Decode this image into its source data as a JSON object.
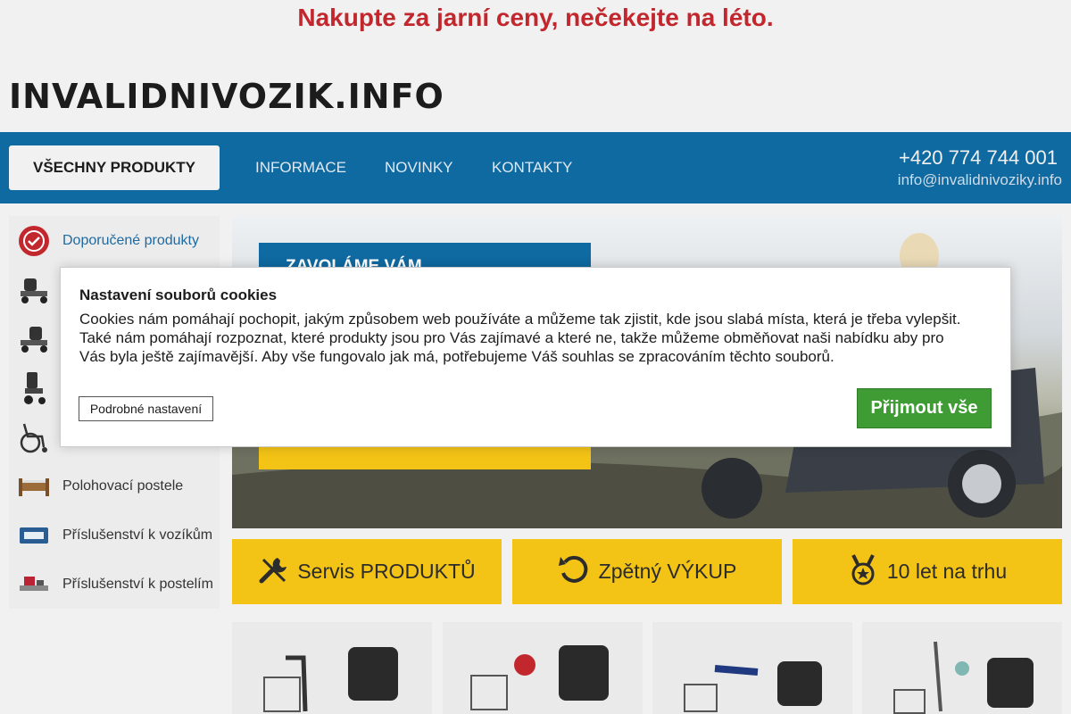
{
  "promo_banner": "Nakupte za jarní ceny, nečekejte na léto.",
  "logo": "INVALIDNIVOZIK.INFO",
  "nav": {
    "all_products": "VŠECHNY PRODUKTY",
    "links": [
      "INFORMACE",
      "NOVINKY",
      "KONTAKTY"
    ],
    "phone": "+420 774 744 001",
    "email": "info@invalidnivoziky.info"
  },
  "sidebar": {
    "items": [
      {
        "label": "Doporučené produkty",
        "icon": "recommended-badge-icon"
      },
      {
        "label": "",
        "icon": "mobility-scooter-icon"
      },
      {
        "label": "",
        "icon": "mobility-scooter-icon"
      },
      {
        "label": "",
        "icon": "electric-wheelchair-icon"
      },
      {
        "label": "",
        "icon": "wheelchair-icon"
      },
      {
        "label": "Polohovací postele",
        "icon": "bed-icon"
      },
      {
        "label": "Příslušenství k vozíkům",
        "icon": "wheelchair-accessory-icon"
      },
      {
        "label": "Příslušenství k postelím",
        "icon": "bed-accessory-icon"
      }
    ]
  },
  "hero": {
    "box_title": "ZAVOLÁME VÁM"
  },
  "features": [
    {
      "label": "Servis PRODUKTŮ",
      "icon": "tools-icon"
    },
    {
      "label": "Zpětný VÝKUP",
      "icon": "return-arrow-icon"
    },
    {
      "label": "10 let na trhu",
      "icon": "medal-icon"
    }
  ],
  "cookie_dialog": {
    "title": "Nastavení souborů cookies",
    "text": "Cookies nám pomáhají pochopit, jakým způsobem web používáte a můžeme tak zjistit, kde jsou slabá místa, která je třeba vylepšit. Také nám pomáhají rozpoznat, které produkty jsou pro Vás zajímavé a které ne, takže můžeme obměňovat naši nabídku aby pro Vás byla ještě zajímavější. Aby vše fungovalo jak má, potřebujeme Váš souhlas se zpracováním těchto souborů.",
    "settings_button": "Podrobné nastavení",
    "accept_button": "Přijmout vše"
  },
  "colors": {
    "brand_blue": "#0e6aa1",
    "accent_yellow": "#f3c316",
    "promo_red": "#c3272e",
    "accept_green": "#3f9c35"
  }
}
